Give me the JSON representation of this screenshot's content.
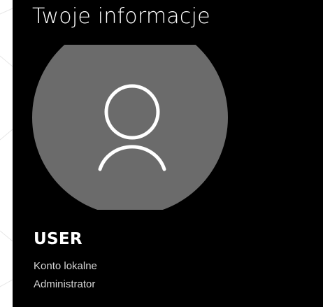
{
  "window": {
    "title": "Twoje informacje"
  },
  "user": {
    "name": "USER",
    "account_type": "Konto lokalne",
    "role": "Administrator"
  },
  "avatar": {
    "icon": "person-icon",
    "background_color": "#6b6b6b",
    "icon_color": "#ffffff"
  },
  "colors": {
    "panel_background": "#000000",
    "accent": "#7fbf3f"
  }
}
